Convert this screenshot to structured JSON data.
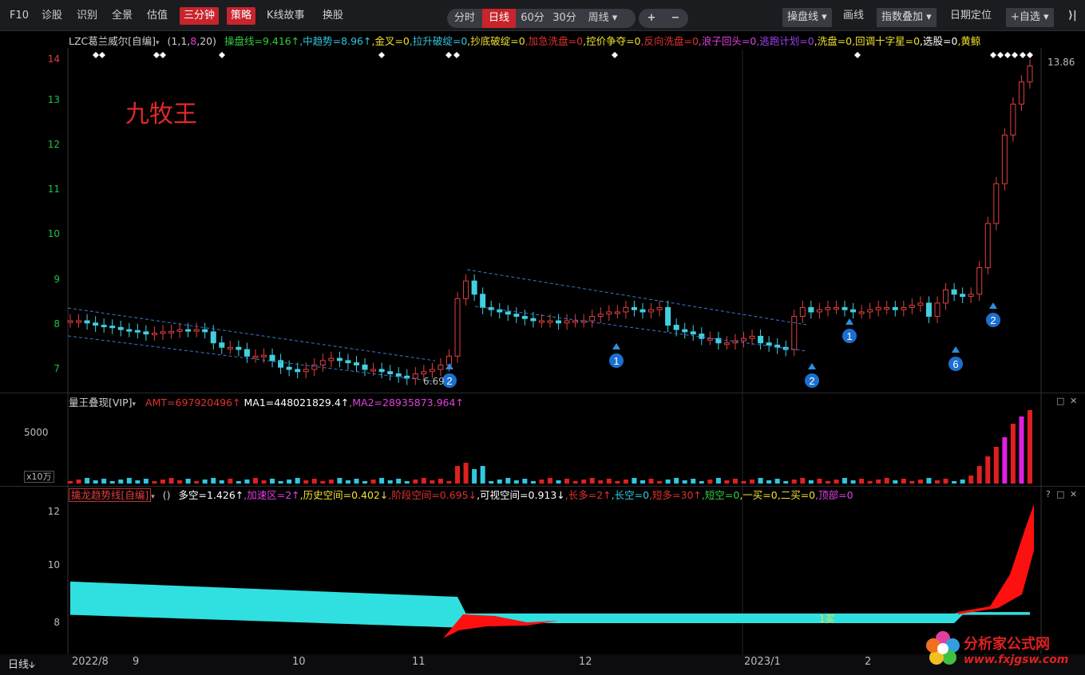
{
  "toolbar": {
    "left_items": [
      "F10",
      "诊股",
      "识别",
      "全景",
      "估值"
    ],
    "red_items": [
      "三分钟",
      "策略"
    ],
    "mid_items": [
      "K线故事",
      "换股"
    ],
    "periods": [
      "分时",
      "日线",
      "60分",
      "30分",
      "周线"
    ],
    "active_period": "日线",
    "zoom_in": "+",
    "zoom_out": "−",
    "right_items": [
      "操盘线",
      "画线",
      "指数叠加",
      "日期定位",
      "+自选"
    ],
    "collapse": "⟩|"
  },
  "main_panel": {
    "indicator_name": "LZC葛兰威尔[自编]",
    "params": "(1,1,8,20)",
    "values": [
      {
        "text": "操盘线=9.416↑",
        "color": "#30d040"
      },
      {
        "text": ",中趋势=8.96↑",
        "color": "#30c8e0"
      },
      {
        "text": ",金叉=0",
        "color": "#f0e030"
      },
      {
        "text": ",拉升破绽=0",
        "color": "#30c8e0"
      },
      {
        "text": ",抄底破绽=0",
        "color": "#f0e030"
      },
      {
        "text": ",加急洗盘=0",
        "color": "#e03030"
      },
      {
        "text": ",控价争夺=0",
        "color": "#f0e030"
      },
      {
        "text": ",反向洗盘=0",
        "color": "#e03030"
      },
      {
        "text": ",浪子回头=0",
        "color": "#e040e0"
      },
      {
        "text": ",逃跑计划=0",
        "color": "#a040f0"
      },
      {
        "text": ",洗盘=0",
        "color": "#f0e030"
      },
      {
        "text": ",回调十字星=0",
        "color": "#f0e030"
      },
      {
        "text": ",选股=0",
        "color": "#ffffff"
      },
      {
        "text": ",黄鲸",
        "color": "#f0e030"
      }
    ],
    "watermark": "九牧王",
    "y_ticks": [
      "14",
      "13",
      "12",
      "11",
      "10",
      "9",
      "8",
      "7"
    ],
    "price_low_label": "6.69",
    "price_high_label": "13.86",
    "markers": [
      "2",
      "1",
      "2",
      "1",
      "6",
      "2"
    ]
  },
  "volume_panel": {
    "indicator_name": "量王叠现[VIP]",
    "values": [
      {
        "text": "AMT=697920496↑",
        "color": "#e03030"
      },
      {
        "text": " MA1=448021829.4↑",
        "color": "#ffffff"
      },
      {
        "text": ",MA2=28935873.964↑",
        "color": "#e040e0"
      }
    ],
    "y_tick": "5000",
    "unit": "x10万"
  },
  "trend_panel": {
    "indicator_name": "擒龙趋势线[自编]",
    "params": "()",
    "values": [
      {
        "text": "多空=1.426↑",
        "color": "#ffffff"
      },
      {
        "text": ",加速区=2↑",
        "color": "#e040e0"
      },
      {
        "text": ",历史空间=0.402↓",
        "color": "#f0e030"
      },
      {
        "text": ",阶段空间=0.695↓",
        "color": "#e03030"
      },
      {
        "text": ",可视空间=0.913↓",
        "color": "#ffffff"
      },
      {
        "text": ",长多=2↑",
        "color": "#e03030"
      },
      {
        "text": ",长空=0",
        "color": "#30c8e0"
      },
      {
        "text": ",短多=30↑",
        "color": "#e03030"
      },
      {
        "text": ",短空=0",
        "color": "#30d040"
      },
      {
        "text": ",一买=0",
        "color": "#f0e030"
      },
      {
        "text": ",二买=0",
        "color": "#f0e030"
      },
      {
        "text": ",顶部=0",
        "color": "#e040e0"
      }
    ],
    "y_ticks": [
      "12",
      "10",
      "8"
    ],
    "buy_label": "1买"
  },
  "time_axis": {
    "period_label": "日线",
    "labels": [
      "2022/8",
      "9",
      "10",
      "11",
      "12",
      "2023/1",
      "2"
    ]
  },
  "logo": {
    "cn": "分析家公式网",
    "url": "www.fxjgsw.com"
  }
}
